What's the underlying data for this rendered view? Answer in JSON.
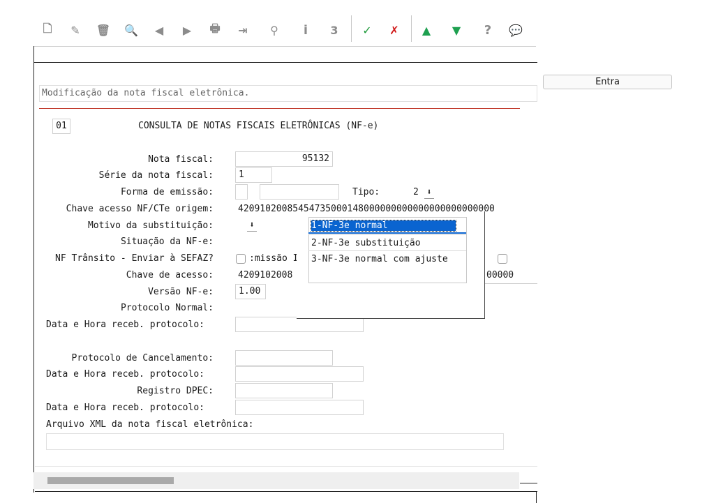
{
  "toolbar": {
    "buttons": [
      {
        "name": "new-record-icon",
        "glyph": "🗋"
      },
      {
        "name": "edit-icon",
        "glyph": "✎"
      },
      {
        "name": "delete-icon",
        "glyph": "🗑"
      },
      {
        "name": "search-icon",
        "glyph": "🔍"
      },
      {
        "name": "previous-icon",
        "glyph": "◀"
      },
      {
        "name": "next-icon",
        "glyph": "▶"
      },
      {
        "name": "print-icon",
        "glyph": "🖶"
      },
      {
        "name": "import-icon",
        "glyph": "⇥"
      },
      {
        "name": "binoculars-icon",
        "glyph": "⚲"
      },
      {
        "name": "info-icon",
        "glyph": "i"
      },
      {
        "name": "numbered-list-icon",
        "glyph": "3"
      },
      {
        "name": "confirm-check-icon",
        "glyph": "✓"
      },
      {
        "name": "cancel-x-icon",
        "glyph": "✗"
      },
      {
        "name": "arrow-up-icon",
        "glyph": "▲"
      },
      {
        "name": "arrow-down-icon",
        "glyph": "▼"
      },
      {
        "name": "help-icon",
        "glyph": "?"
      },
      {
        "name": "comment-icon",
        "glyph": "💬"
      }
    ]
  },
  "side_button": {
    "label": "Entra"
  },
  "status_message": "Modificação da nota fiscal eletrônica.",
  "form": {
    "page_number": "01",
    "title": "CONSULTA DE NOTAS FISCAIS ELETRÔNICAS (NF-e)",
    "nota_fiscal_label": "Nota fiscal:",
    "nota_fiscal_value": "95132",
    "serie_label": "Série da nota fiscal:",
    "serie_value": "1",
    "forma_emissao_label": "Forma de emissão:",
    "tipo_label": "Tipo:",
    "tipo_value": "2",
    "chave_origem_label": "Chave acesso NF/CTe origem:",
    "chave_origem_value": "42091020085454735000148000000000000000000000000",
    "motivo_label": "Motivo da substituição:",
    "situacao_label": "Situação da NF-e:",
    "nf_transito_label": "NF Trânsito - Enviar à SEFAZ?",
    "emissao_partial": ":missão I",
    "chave_acesso_label": "Chave de acesso:",
    "chave_acesso_value": "4209102008",
    "chave_acesso_tail": "00000",
    "versao_label": "Versão NF-e:",
    "versao_value": "1.00",
    "protocolo_normal_label": "Protocolo Normal:",
    "data_hora_label_1": "Data e Hora receb. protocolo:",
    "protocolo_cancel_label": "Protocolo de Cancelamento:",
    "data_hora_label_2": "Data e Hora receb. protocolo:",
    "registro_dpec_label": "Registro DPEC:",
    "data_hora_label_3": "Data e Hora receb. protocolo:",
    "arquivo_xml_label": "Arquivo XML da nota fiscal eletrônica:"
  },
  "dropdown": {
    "options": [
      {
        "label": "1-NF-3e normal",
        "selected": true
      },
      {
        "label": "2-NF-3e substituição",
        "selected": false
      },
      {
        "label": "3-NF-3e normal com ajuste",
        "selected": false
      }
    ]
  },
  "colors": {
    "selection": "#0a64d0",
    "accent_line": "#c0392b",
    "confirm": "#1e9a3a",
    "cancel": "#d01818",
    "arrow": "#1ea050"
  }
}
